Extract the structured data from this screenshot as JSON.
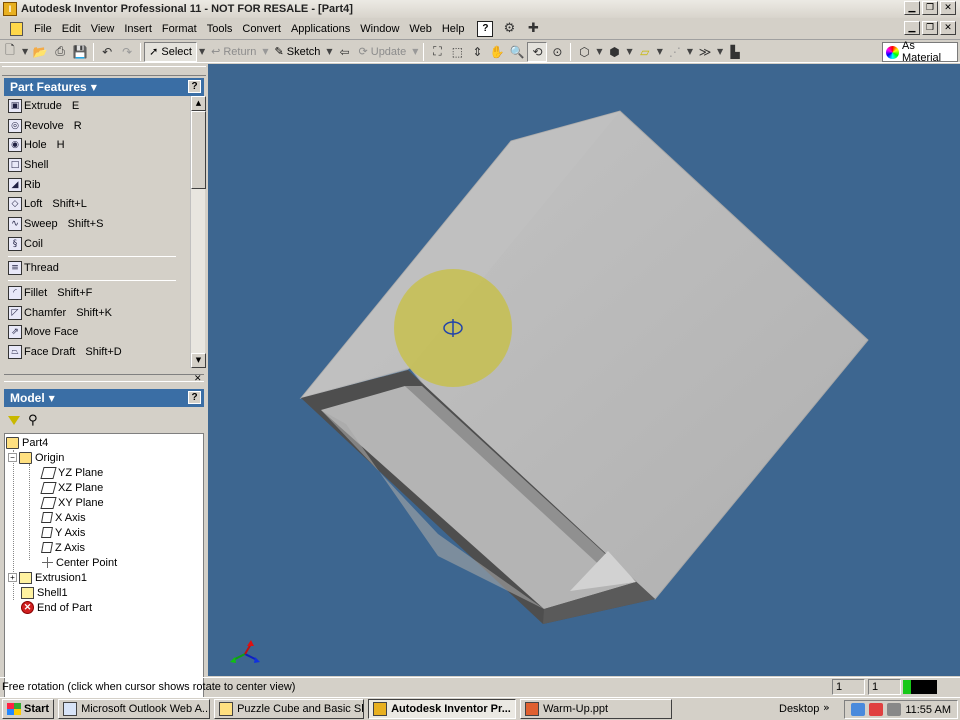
{
  "window": {
    "title": "Autodesk Inventor Professional 11 - NOT FOR RESALE - [Part4]"
  },
  "menu": {
    "items": [
      "File",
      "Edit",
      "View",
      "Insert",
      "Format",
      "Tools",
      "Convert",
      "Applications",
      "Window",
      "Web",
      "Help"
    ]
  },
  "toolbar": {
    "select_label": "Select",
    "return_label": "Return",
    "sketch_label": "Sketch",
    "update_label": "Update",
    "material_label": "As Material"
  },
  "features_panel": {
    "title": "Part Features",
    "items": [
      {
        "label": "Extrude",
        "key": "E"
      },
      {
        "label": "Revolve",
        "key": "R"
      },
      {
        "label": "Hole",
        "key": "H"
      },
      {
        "label": "Shell",
        "key": ""
      },
      {
        "label": "Rib",
        "key": ""
      },
      {
        "label": "Loft",
        "key": "Shift+L"
      },
      {
        "label": "Sweep",
        "key": "Shift+S"
      },
      {
        "label": "Coil",
        "key": ""
      },
      {
        "label": "Thread",
        "key": ""
      },
      {
        "label": "Fillet",
        "key": "Shift+F"
      },
      {
        "label": "Chamfer",
        "key": "Shift+K"
      },
      {
        "label": "Move Face",
        "key": ""
      },
      {
        "label": "Face Draft",
        "key": "Shift+D"
      }
    ]
  },
  "model_panel": {
    "title": "Model",
    "tree": [
      {
        "label": "Part4"
      },
      {
        "label": "Origin"
      },
      {
        "label": "YZ Plane"
      },
      {
        "label": "XZ Plane"
      },
      {
        "label": "XY Plane"
      },
      {
        "label": "X Axis"
      },
      {
        "label": "Y Axis"
      },
      {
        "label": "Z Axis"
      },
      {
        "label": "Center Point"
      },
      {
        "label": "Extrusion1"
      },
      {
        "label": "Shell1"
      },
      {
        "label": "End of Part"
      }
    ]
  },
  "statusbar": {
    "message": "Free rotation (click when cursor shows rotate to center view)",
    "field1": "1",
    "field2": "1"
  },
  "taskbar": {
    "start_label": "Start",
    "buttons": [
      {
        "label": "Microsoft Outlook Web A..."
      },
      {
        "label": "Puzzle Cube and Basic Skills"
      },
      {
        "label": "Autodesk Inventor Pr..."
      },
      {
        "label": "Warm-Up.ppt"
      }
    ],
    "desktop_label": "Desktop",
    "clock": "11:55 AM"
  },
  "colors": {
    "viewport_bg": "#3d6690",
    "panel_header": "#3a6ea5",
    "cursor_highlight": "#c8c040"
  }
}
